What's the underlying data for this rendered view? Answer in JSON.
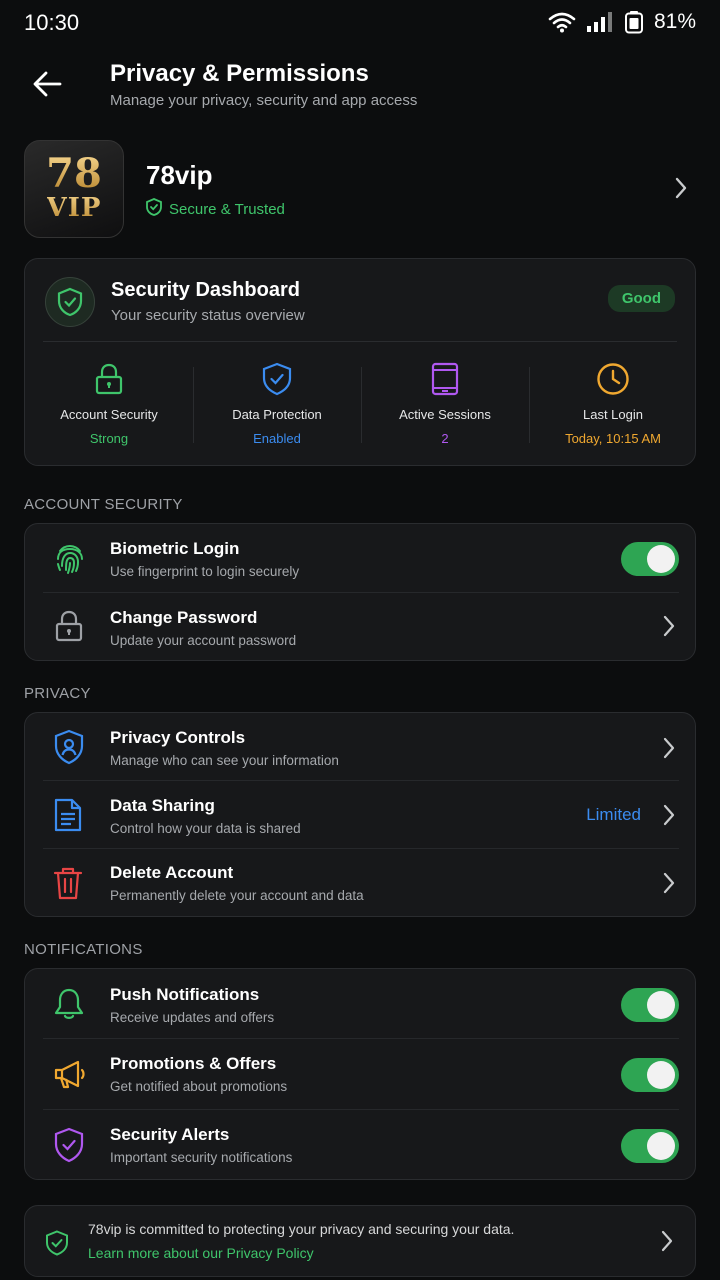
{
  "status_bar": {
    "time": "10:30",
    "battery": "81%"
  },
  "header": {
    "title": "Privacy & Permissions",
    "subtitle": "Manage your privacy, security and app access"
  },
  "profile": {
    "logo_number": "78",
    "logo_text": "VIP",
    "name": "78vip",
    "badge": "Secure & Trusted"
  },
  "dashboard": {
    "title": "Security Dashboard",
    "subtitle": "Your security status overview",
    "status": "Good",
    "stats": [
      {
        "label": "Account Security",
        "value": "Strong",
        "color": "#3fc56b",
        "icon": "lock-icon"
      },
      {
        "label": "Data Protection",
        "value": "Enabled",
        "color": "#3b8cf0",
        "icon": "shield-check-icon"
      },
      {
        "label": "Active Sessions",
        "value": "2",
        "color": "#b058f0",
        "icon": "device-icon"
      },
      {
        "label": "Last Login",
        "value": "Today, 10:15 AM",
        "color": "#f0a830",
        "icon": "clock-icon"
      }
    ]
  },
  "account_security": {
    "heading": "ACCOUNT SECURITY",
    "items": [
      {
        "title": "Biometric Login",
        "subtitle": "Use fingerprint to login securely",
        "enabled": true
      },
      {
        "title": "Change Password",
        "subtitle": "Update your account password"
      }
    ]
  },
  "privacy": {
    "heading": "PRIVACY",
    "items": [
      {
        "title": "Privacy Controls",
        "subtitle": "Manage who can see your information"
      },
      {
        "title": "Data Sharing",
        "subtitle": "Control how your data is shared",
        "value": "Limited"
      },
      {
        "title": "Delete Account",
        "subtitle": "Permanently delete your account and data"
      }
    ]
  },
  "notifications": {
    "heading": "NOTIFICATIONS",
    "items": [
      {
        "title": "Push Notifications",
        "subtitle": "Receive updates and offers",
        "enabled": true
      },
      {
        "title": "Promotions & Offers",
        "subtitle": "Get notified about promotions",
        "enabled": true
      },
      {
        "title": "Security Alerts",
        "subtitle": "Important security notifications",
        "enabled": true
      }
    ]
  },
  "footer": {
    "text": "78vip is committed to protecting your privacy and securing your data.",
    "link": "Learn more about our Privacy Policy"
  },
  "colors": {
    "green": "#3fc56b",
    "blue": "#3b8cf0",
    "purple": "#b058f0",
    "orange": "#f0a830",
    "red": "#e84545",
    "toggle_on": "#2ea553"
  }
}
